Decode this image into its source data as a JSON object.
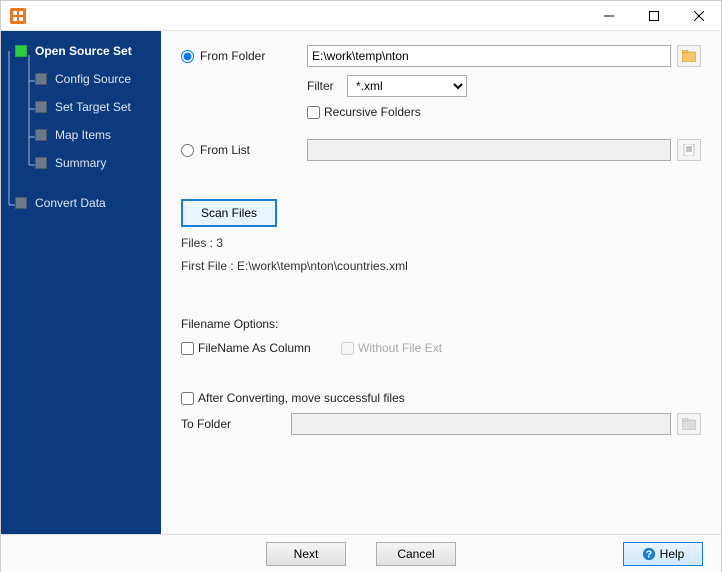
{
  "sidebar": {
    "items": [
      {
        "label": "Open Source Set"
      },
      {
        "label": "Config Source"
      },
      {
        "label": "Set Target Set"
      },
      {
        "label": "Map Items"
      },
      {
        "label": "Summary"
      },
      {
        "label": "Convert Data"
      }
    ]
  },
  "source": {
    "from_folder_label": "From Folder",
    "folder_path": "E:\\work\\temp\\nton",
    "filter_label": "Filter",
    "filter_value": "*.xml",
    "recursive_label": "Recursive Folders",
    "from_list_label": "From List",
    "from_list_value": ""
  },
  "scan": {
    "button_label": "Scan Files",
    "files_count": "Files : 3",
    "first_file": "First File : E:\\work\\temp\\nton\\countries.xml"
  },
  "filename_options": {
    "heading": "Filename Options:",
    "as_column_label": "FileName As Column",
    "without_ext_label": "Without File Ext"
  },
  "after": {
    "move_label": "After Converting, move successful files",
    "to_folder_label": "To Folder",
    "to_folder_value": ""
  },
  "footer": {
    "next": "Next",
    "cancel": "Cancel",
    "help": "Help"
  }
}
